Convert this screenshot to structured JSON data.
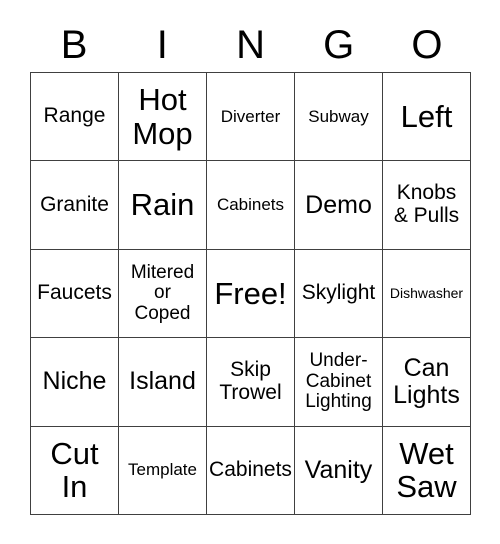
{
  "card": {
    "title_letters": [
      "B",
      "I",
      "N",
      "G",
      "O"
    ],
    "columns": 5,
    "rows": 5,
    "free_space_label": "Free!",
    "free_space_position": {
      "row": 3,
      "column": 3
    },
    "border_color": "#404040",
    "background_color": "#ffffff",
    "text_color": "#000000",
    "cells": [
      [
        {
          "label": "Range",
          "size": "md"
        },
        {
          "label": "Hot\nMop",
          "size": "xl"
        },
        {
          "label": "Diverter",
          "size": "xs"
        },
        {
          "label": "Subway",
          "size": "xs"
        },
        {
          "label": "Left",
          "size": "xl"
        }
      ],
      [
        {
          "label": "Granite",
          "size": "md"
        },
        {
          "label": "Rain",
          "size": "xl"
        },
        {
          "label": "Cabinets",
          "size": "xs"
        },
        {
          "label": "Demo",
          "size": "lg"
        },
        {
          "label": "Knobs\n& Pulls",
          "size": "md"
        }
      ],
      [
        {
          "label": "Faucets",
          "size": "md"
        },
        {
          "label": "Mitered\nor\nCoped",
          "size": "sm"
        },
        {
          "label": "Free!",
          "size": "xl"
        },
        {
          "label": "Skylight",
          "size": "md"
        },
        {
          "label": "Dishwasher",
          "size": "xxs"
        }
      ],
      [
        {
          "label": "Niche",
          "size": "lg"
        },
        {
          "label": "Island",
          "size": "lg"
        },
        {
          "label": "Skip\nTrowel",
          "size": "md"
        },
        {
          "label": "Under-\nCabinet\nLighting",
          "size": "sm"
        },
        {
          "label": "Can\nLights",
          "size": "lg"
        }
      ],
      [
        {
          "label": "Cut\nIn",
          "size": "xl"
        },
        {
          "label": "Template",
          "size": "xs"
        },
        {
          "label": "Cabinets",
          "size": "md"
        },
        {
          "label": "Vanity",
          "size": "lg"
        },
        {
          "label": "Wet\nSaw",
          "size": "xl"
        }
      ]
    ]
  }
}
